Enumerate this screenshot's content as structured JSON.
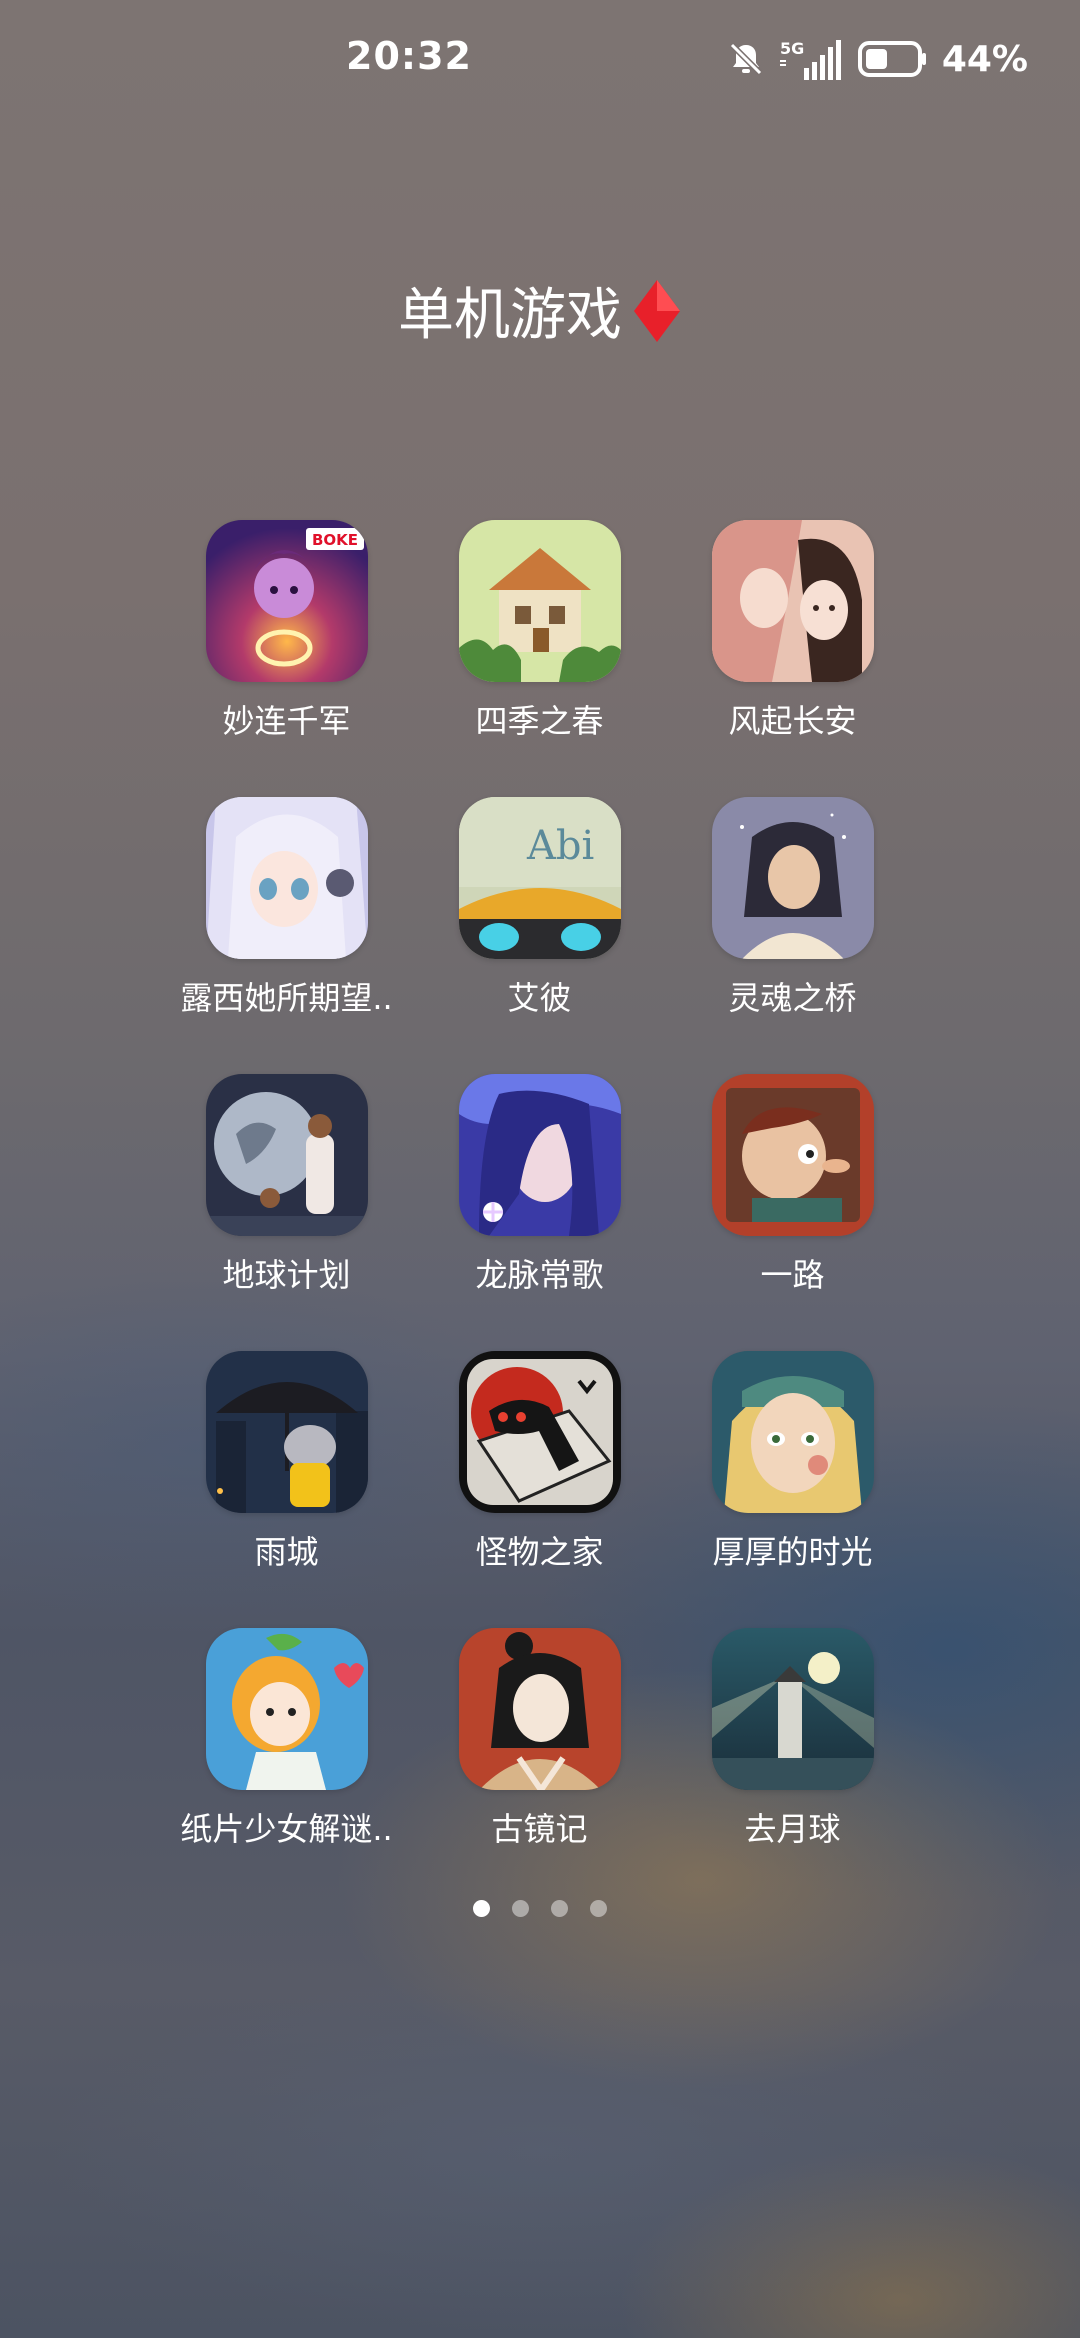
{
  "status_bar": {
    "time": "20:32",
    "network": "5G",
    "battery_percent": "44%",
    "battery_level": 0.44,
    "icons": [
      "bell-muted-icon",
      "signal-5g-icon",
      "battery-icon"
    ]
  },
  "folder": {
    "title": "单机游戏",
    "title_badge": "red-diamond-icon",
    "badge_color": "#e8202a"
  },
  "apps": [
    {
      "label": "妙连千军",
      "icon": "miaolian-qianjun-icon",
      "badge_text": "BOKE"
    },
    {
      "label": "四季之春",
      "icon": "four-seasons-spring-icon"
    },
    {
      "label": "风起长安",
      "icon": "fengqi-changan-icon"
    },
    {
      "label": "露西她所期望..",
      "icon": "lucy-icon"
    },
    {
      "label": "艾彼",
      "icon": "abi-icon",
      "icon_text": "Abi"
    },
    {
      "label": "灵魂之桥",
      "icon": "soul-bridge-icon"
    },
    {
      "label": "地球计划",
      "icon": "earth-project-icon"
    },
    {
      "label": "龙脉常歌",
      "icon": "dragon-vein-icon"
    },
    {
      "label": "一路",
      "icon": "yilu-icon"
    },
    {
      "label": "雨城",
      "icon": "rain-city-icon"
    },
    {
      "label": "怪物之家",
      "icon": "monster-house-icon"
    },
    {
      "label": "厚厚的时光",
      "icon": "thick-time-icon"
    },
    {
      "label": "纸片少女解谜..",
      "icon": "paper-girl-icon"
    },
    {
      "label": "古镜记",
      "icon": "ancient-mirror-icon"
    },
    {
      "label": "去月球",
      "icon": "to-the-moon-icon"
    }
  ],
  "pagination": {
    "pages": 4,
    "current": 1
  }
}
